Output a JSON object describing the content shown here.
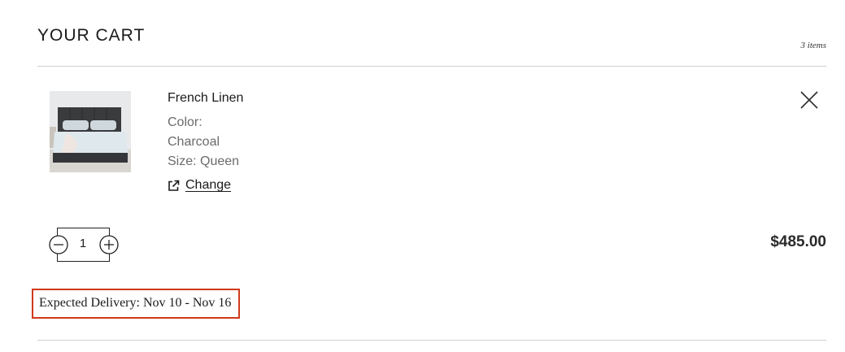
{
  "cart": {
    "title": "YOUR CART",
    "item_count_text": "3 items"
  },
  "item": {
    "image_alt": "Charcoal upholstered bed",
    "name": "French Linen",
    "color_label": "Color:",
    "color_value": "Charcoal",
    "size_text": "Size: Queen",
    "change_label": "Change",
    "quantity": "1",
    "price": "$485.00",
    "delivery_text": "Expected Delivery: Nov 10 - Nov 16"
  },
  "icons": {
    "remove": "close-icon",
    "change": "external-link-icon",
    "decrease": "minus-circle-icon",
    "increase": "plus-circle-icon"
  },
  "colors": {
    "highlight_border": "#d0391b",
    "divider": "#cfcfcf",
    "text_primary": "#1a1a1a",
    "text_secondary": "#6b6b6b"
  }
}
